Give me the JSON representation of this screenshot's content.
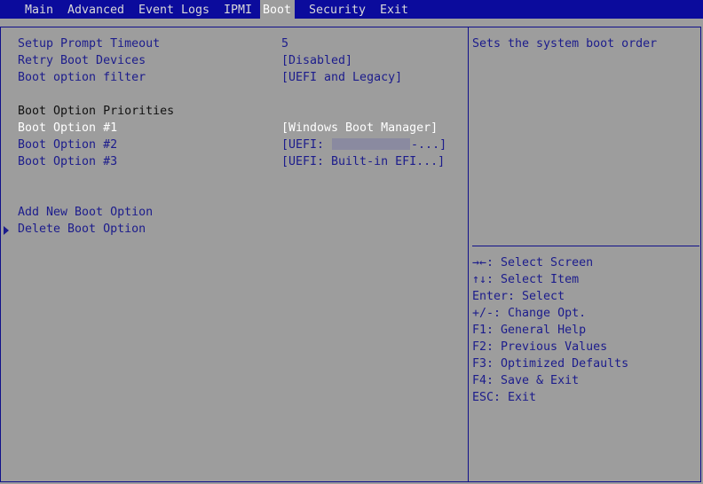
{
  "tabs": [
    "Main",
    "Advanced",
    "Event Logs",
    "IPMI",
    "Boot",
    "Security",
    "Exit"
  ],
  "active_tab": "Boot",
  "settings": [
    {
      "label": "Setup Prompt Timeout",
      "value": "5"
    },
    {
      "label": "Retry Boot Devices",
      "value": "[Disabled]"
    },
    {
      "label": "Boot option filter",
      "value": "[UEFI and Legacy]"
    }
  ],
  "priorities_heading": "Boot Option Priorities",
  "boot_options": [
    {
      "label": "Boot Option #1",
      "value": "[Windows Boot Manager]"
    },
    {
      "label": "Boot Option #2",
      "value_prefix": "[UEFI: ",
      "value_suffix": "-...]"
    },
    {
      "label": "Boot Option #3",
      "value": "[UEFI: Built-in EFI...]"
    }
  ],
  "actions": [
    "Add New Boot Option",
    "Delete Boot Option"
  ],
  "help_text": "Sets the system boot order",
  "key_help": [
    "→←: Select Screen",
    "↑↓: Select Item",
    "Enter: Select",
    "+/-: Change Opt.",
    "F1: General Help",
    "F2: Previous Values",
    "F3: Optimized Defaults",
    "F4: Save & Exit",
    "ESC: Exit"
  ],
  "colors": {
    "topbar": "#0b0b9c",
    "background": "#9d9d9d",
    "text": "#1c1c8c",
    "selected": "#ffffff"
  }
}
